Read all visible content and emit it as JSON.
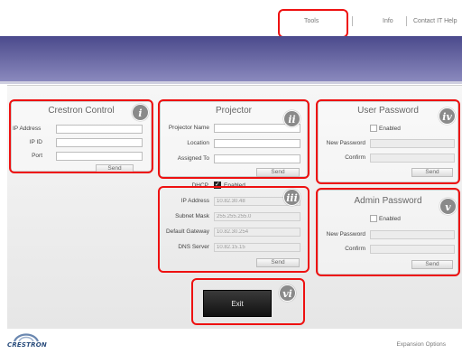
{
  "nav": {
    "tools": "Tools",
    "info": "Info",
    "contact": "Contact IT Help"
  },
  "crestron_control": {
    "title": "Crestron Control",
    "ip_address_label": "IP Address",
    "ip_id_label": "IP ID",
    "port_label": "Port",
    "send_label": "Send"
  },
  "projector": {
    "title": "Projector",
    "name_label": "Projector Name",
    "location_label": "Location",
    "assigned_to_label": "Assigned To",
    "send_label": "Send"
  },
  "network": {
    "dhcp_label": "DHCP",
    "dhcp_enabled_label": "Enabled",
    "ip_address_label": "IP Address",
    "ip_address_value": "10.82.30.48",
    "subnet_mask_label": "Subnet Mask",
    "subnet_mask_value": "255.255.255.0",
    "default_gateway_label": "Default Gateway",
    "default_gateway_value": "10.82.30.254",
    "dns_server_label": "DNS Server",
    "dns_server_value": "10.82.15.15",
    "send_label": "Send"
  },
  "user_password": {
    "title": "User Password",
    "enabled_label": "Enabled",
    "new_password_label": "New Password",
    "confirm_label": "Confirm",
    "send_label": "Send"
  },
  "admin_password": {
    "title": "Admin Password",
    "enabled_label": "Enabled",
    "new_password_label": "New Password",
    "confirm_label": "Confirm",
    "send_label": "Send"
  },
  "exit_label": "Exit",
  "callouts": {
    "i": "i",
    "ii": "ii",
    "iii": "iii",
    "iv": "iv",
    "v": "v",
    "vi": "vi"
  },
  "footer": {
    "logo": "CRESTRON",
    "expansion": "Expansion Options"
  },
  "colors": {
    "callout": "#ee1111",
    "banner_top": "#4b4a8c",
    "banner_bottom": "#8a89bd"
  }
}
